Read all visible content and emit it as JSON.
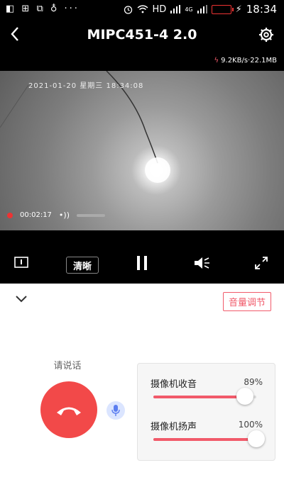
{
  "statusbar": {
    "time": "18:34",
    "hd": "HD",
    "network": "4G",
    "left_icons": "◧ ⊞ ⧉ ♁ ···"
  },
  "header": {
    "title": "MIPC451-4 2.0",
    "back_icon": "chevron-left-icon",
    "settings_icon": "gear-icon"
  },
  "netspeed": "9.2KB/s·22.1MB",
  "video": {
    "timestamp": "2021-01-20 星期三 18:34:08",
    "rec_time": "00:02:17"
  },
  "controls": {
    "clarity_label": "清晰"
  },
  "panel": {
    "volume_adjust_label": "音量调节",
    "speak_label": "请说话",
    "sliders": [
      {
        "label": "摄像机收音",
        "value_text": "89%",
        "value": 0.89
      },
      {
        "label": "摄像机扬声",
        "value_text": "100%",
        "value": 1.0
      }
    ]
  },
  "colors": {
    "accent": "#f15a6a",
    "hangup": "#f24949",
    "mic_bg": "#dbe5ff"
  }
}
